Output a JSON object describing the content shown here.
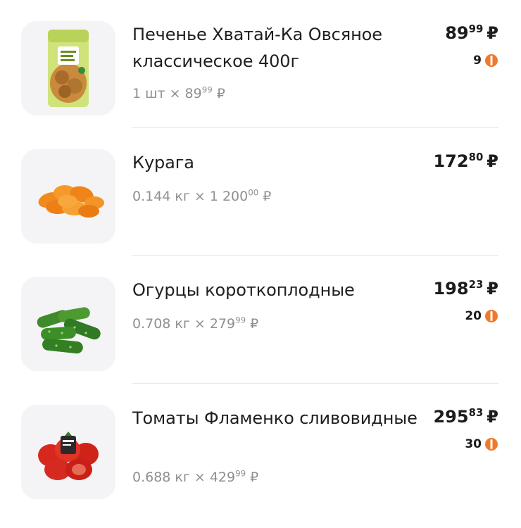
{
  "currency": "₽",
  "colors": {
    "bonus": "#f07a2a",
    "divider": "#e6e6e8",
    "thumb_bg": "#f4f4f6",
    "muted_text": "#8f8f94"
  },
  "items": [
    {
      "name": "Печенье Хватай-Ка Овсяное классическое 400г",
      "qty": "1 шт",
      "unit_price_int": "89",
      "unit_price_frac": "99",
      "price_int": "89",
      "price_frac": "99",
      "bonus": "9",
      "image": "oat-cookies-pack-icon"
    },
    {
      "name": "Курага",
      "qty": "0.144 кг",
      "unit_price_int": "1 200",
      "unit_price_frac": "00",
      "price_int": "172",
      "price_frac": "80",
      "bonus": "",
      "image": "dried-apricots-icon"
    },
    {
      "name": "Огурцы короткоплодные",
      "qty": "0.708 кг",
      "unit_price_int": "279",
      "unit_price_frac": "99",
      "price_int": "198",
      "price_frac": "23",
      "bonus": "20",
      "image": "cucumbers-icon"
    },
    {
      "name": "Томаты Фламенко сливовидные",
      "qty": "0.688 кг",
      "unit_price_int": "429",
      "unit_price_frac": "99",
      "price_int": "295",
      "price_frac": "83",
      "bonus": "30",
      "image": "plum-tomatoes-icon"
    }
  ],
  "times_sign": "×"
}
